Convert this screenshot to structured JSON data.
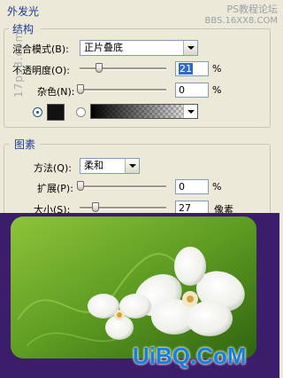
{
  "window": {
    "title": "外发光"
  },
  "top_watermark": {
    "line1": "PS教程论坛",
    "line2": "BBS.16XX8.COM"
  },
  "side_watermark": "17ps8.com",
  "structure": {
    "title": "结构",
    "blend_mode": {
      "label": "混合模式(B):",
      "value": "正片叠底"
    },
    "opacity": {
      "label": "不透明度(O):",
      "value": "21",
      "unit": "%",
      "level_percent": 21
    },
    "noise": {
      "label": "杂色(N):",
      "value": "0",
      "unit": "%",
      "level_percent": 0
    }
  },
  "elements": {
    "title": "图素",
    "technique": {
      "label": "方法(Q):",
      "value": "柔和"
    },
    "spread": {
      "label": "扩展(P):",
      "value": "0",
      "unit": "%",
      "level_percent": 0
    },
    "size": {
      "label": "大小(S):",
      "value": "27",
      "unit": "像素",
      "level_percent": 11
    }
  },
  "bottom_watermark": "UiBQ.CoM",
  "colors": {
    "panel_bg": "#ece9d8",
    "group_title": "#1b3a9c",
    "selection": "#316ac5",
    "canvas_green": "#5e9c22",
    "canvas_purple": "#3b1d6b",
    "watermark_blue": "#1d7fd1"
  }
}
